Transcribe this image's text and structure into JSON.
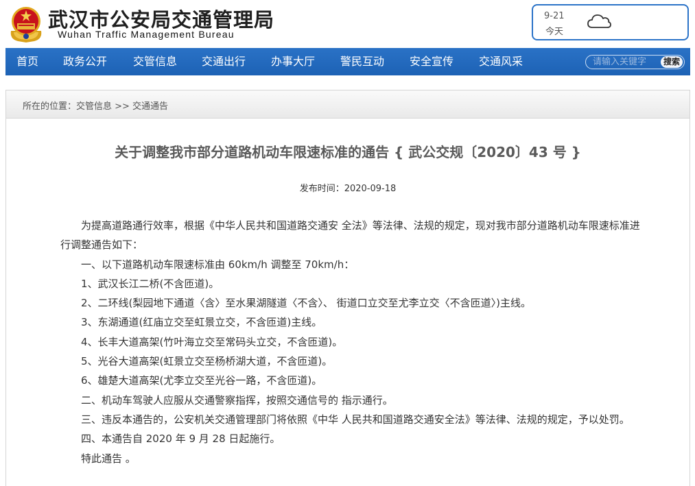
{
  "header": {
    "title": "武汉市公安局交通管理局",
    "subtitle": "Wuhan Traffic Management Bureau",
    "weather": {
      "date": "9-21",
      "day": "今天",
      "icon": "cloud-icon"
    }
  },
  "nav": {
    "items": [
      "首页",
      "政务公开",
      "交管信息",
      "交通出行",
      "办事大厅",
      "警民互动",
      "安全宣传",
      "交通风采"
    ],
    "search_placeholder": "请输入关键字",
    "search_button": "搜索"
  },
  "breadcrumb": {
    "text": "所在的位置：交管信息 >> 交通通告"
  },
  "article": {
    "title": "关于调整我市部分道路机动车限速标准的通告 { 武公交规〔2020〕43 号 }",
    "date_label": "发布时间：",
    "date": "2020-09-18",
    "paragraphs": [
      "为提高道路通行效率，根据《中华人民共和国道路交通安 全法》等法律、法规的规定，现对我市部分道路机动车限速标准进行调整通告如下：",
      "一、以下道路机动车限速标准由 60km/h 调整至 70km/h：",
      "1、武汉长江二桥(不含匝道)。",
      "2、二环线(梨园地下通道〈含〉至水果湖隧道〈不含〉、 街道口立交至尤李立交〈不含匝道〉)主线。",
      "3、东湖通道(红庙立交至虹景立交，不含匝道)主线。",
      "4、长丰大道高架(竹叶海立交至常码头立交，不含匝道)。",
      "5、光谷大道高架(虹景立交至杨桥湖大道，不含匝道)。",
      "6、雄楚大道高架(尤李立交至光谷一路，不含匝道)。",
      "二、机动车驾驶人应服从交通警察指挥，按照交通信号的 指示通行。",
      "三、违反本通告的，公安机关交通管理部门将依照《中华 人民共和国道路交通安全法》等法律、法规的规定，予以处罚。",
      "四、本通告自 2020 年 9 月 28 日起施行。",
      "特此通告 。"
    ]
  },
  "colors": {
    "nav_bg": "#2169bd",
    "weather_border": "#2b73c8",
    "title_text": "#5a5a5a"
  }
}
